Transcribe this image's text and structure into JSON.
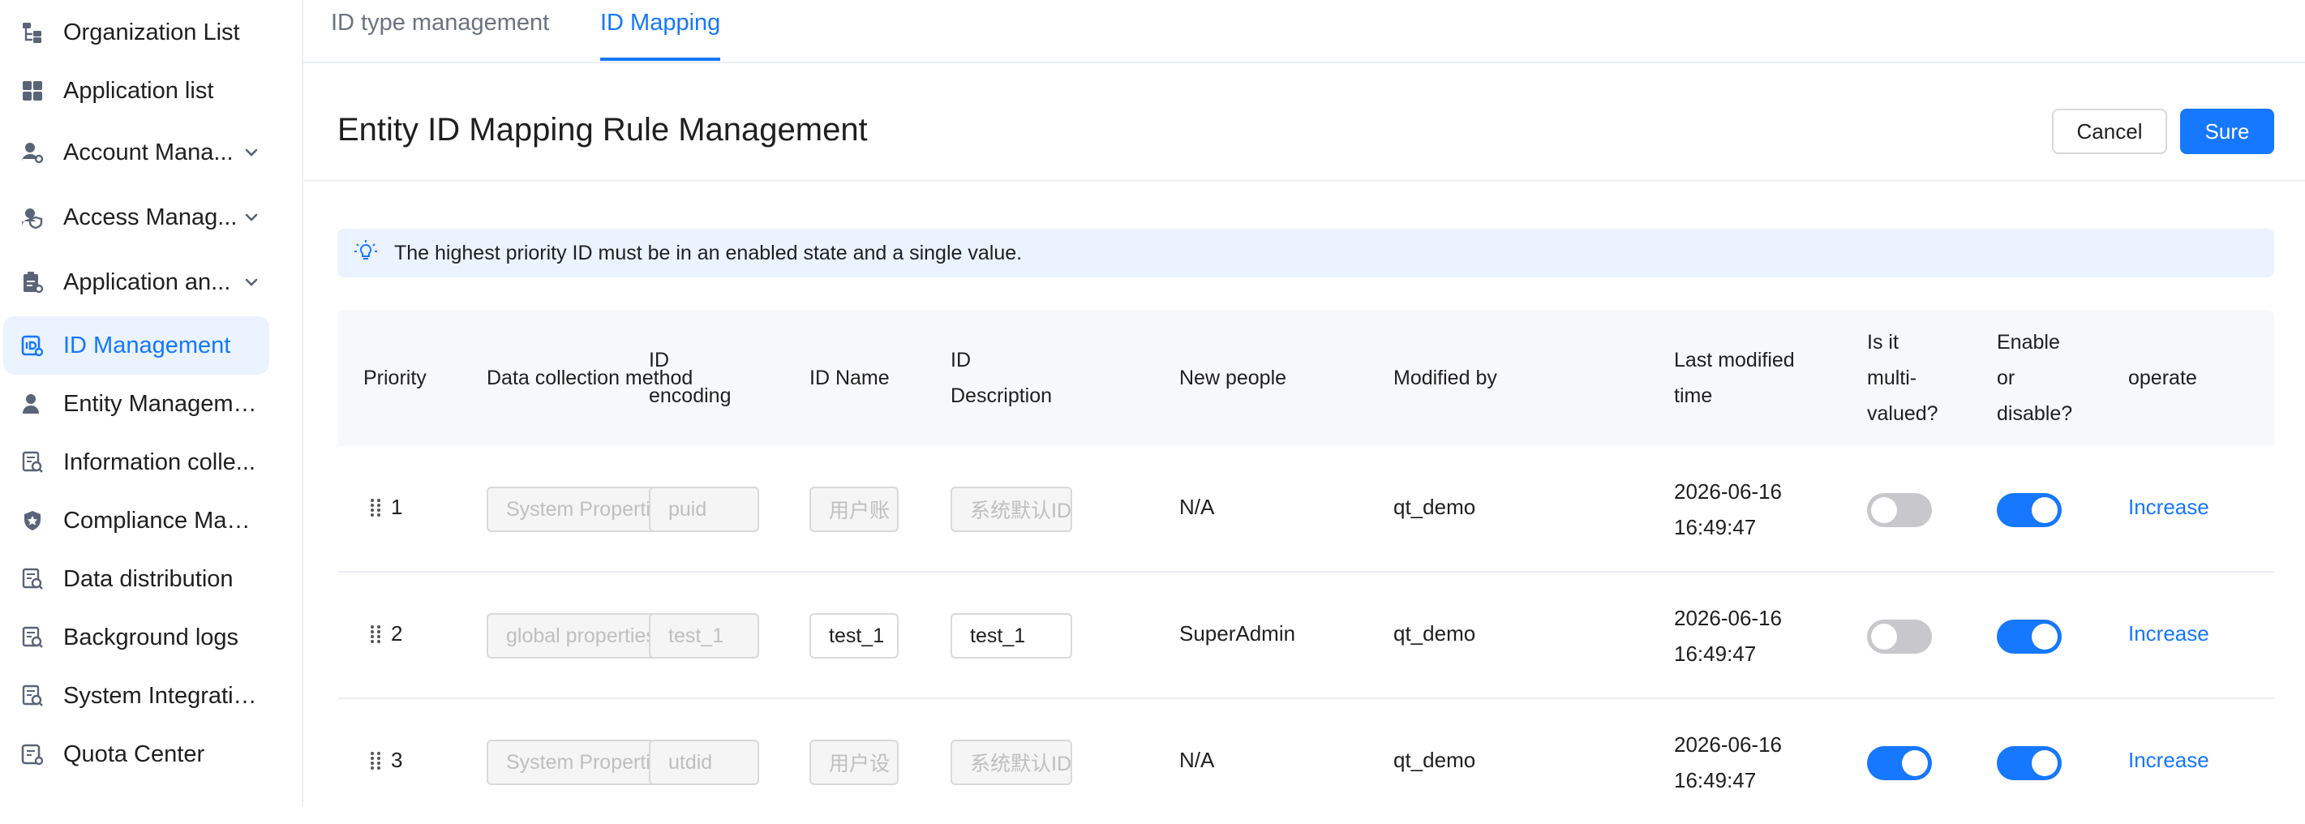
{
  "sidebar": {
    "items": [
      {
        "label": "Organization List",
        "icon": "org-tree-icon"
      },
      {
        "label": "Application list",
        "icon": "grid-icon"
      },
      {
        "label": "Account Mana...",
        "icon": "user-settings-icon",
        "expandable": true
      },
      {
        "label": "Access Manag...",
        "icon": "user-shield-icon",
        "expandable": true
      },
      {
        "label": "Application an...",
        "icon": "clipboard-icon",
        "expandable": true
      },
      {
        "label": "ID Management",
        "icon": "id-icon",
        "active": true
      },
      {
        "label": "Entity Management",
        "icon": "person-icon"
      },
      {
        "label": "Information colle...",
        "icon": "doc-search-icon"
      },
      {
        "label": "Compliance Man...",
        "icon": "shield-icon"
      },
      {
        "label": "Data distribution",
        "icon": "doc-search-icon"
      },
      {
        "label": "Background logs",
        "icon": "doc-search-icon"
      },
      {
        "label": "System Integration",
        "icon": "doc-search-icon"
      },
      {
        "label": "Quota Center",
        "icon": "quota-icon"
      }
    ]
  },
  "tabs": [
    {
      "label": "ID type management",
      "active": false
    },
    {
      "label": "ID Mapping",
      "active": true
    }
  ],
  "header": {
    "title": "Entity ID Mapping Rule Management",
    "cancel_label": "Cancel",
    "sure_label": "Sure"
  },
  "alert": {
    "text": "The highest priority ID must be in an enabled state and a single value.",
    "icon": "lightbulb-icon"
  },
  "table": {
    "headers": {
      "priority": "Priority",
      "method": "Data collection method",
      "encoding_1": "ID",
      "encoding_2": "encoding",
      "name": "ID Name",
      "desc_1": "ID",
      "desc_2": "Description",
      "new_people": "New people",
      "modified_by": "Modified by",
      "time_1": "Last modified",
      "time_2": "time",
      "multi_1": "Is it",
      "multi_2": "multi-",
      "multi_3": "valued?",
      "enable_1": "Enable",
      "enable_2": "or",
      "enable_3": "disable?",
      "operate": "operate"
    },
    "rows": [
      {
        "priority": "1",
        "method": "System Properties",
        "encoding": "puid",
        "name": "用户账",
        "desc": "系统默认ID",
        "name_enabled": false,
        "new_people": "N/A",
        "modified_by": "qt_demo",
        "date": "2026-06-16",
        "clock": "16:49:47",
        "multi": false,
        "enabled": true,
        "action": "Increase"
      },
      {
        "priority": "2",
        "method": "global properties",
        "encoding": "test_1",
        "name": "test_1",
        "desc": "test_1",
        "name_enabled": true,
        "new_people": "SuperAdmin",
        "modified_by": "qt_demo",
        "date": "2026-06-16",
        "clock": "16:49:47",
        "multi": false,
        "enabled": true,
        "action": "Increase"
      },
      {
        "priority": "3",
        "method": "System Properties",
        "encoding": "utdid",
        "name": "用户设",
        "desc": "系统默认ID",
        "name_enabled": false,
        "new_people": "N/A",
        "modified_by": "qt_demo",
        "date": "2026-06-16",
        "clock": "16:49:47",
        "multi": true,
        "enabled": true,
        "action": "Increase"
      }
    ]
  },
  "colors": {
    "accent": "#1677ff",
    "active_bg": "#eaf3ff",
    "toggle_off": "#c7c7cc",
    "header_bg": "#f7f8fa"
  }
}
